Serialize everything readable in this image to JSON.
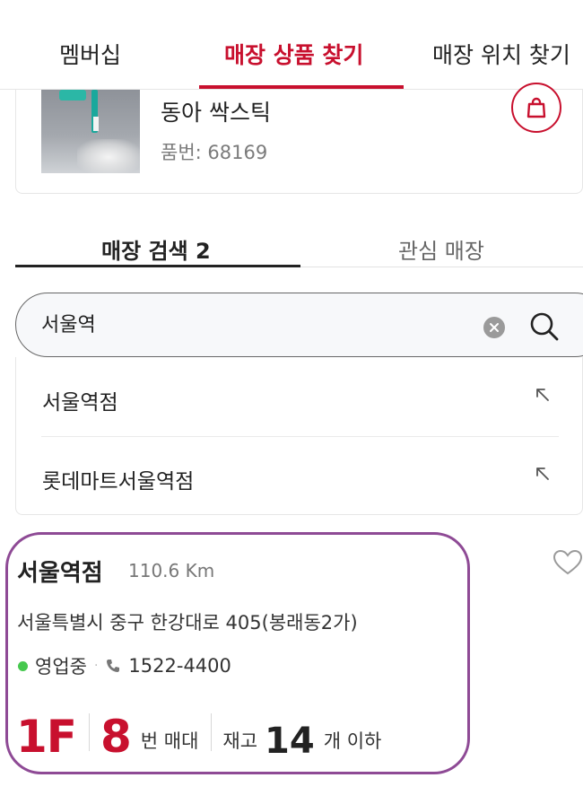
{
  "nav": {
    "tabs": [
      {
        "label": "멤버십"
      },
      {
        "label": "매장 상품 찾기"
      },
      {
        "label": "매장 위치 찾기"
      }
    ],
    "active_index": 1
  },
  "product": {
    "name": "동아 싹스틱",
    "code": "품번: 68169"
  },
  "subtabs": [
    {
      "label": "매장 검색 2"
    },
    {
      "label": "관심 매장"
    }
  ],
  "search": {
    "value": "서울역"
  },
  "suggestions": [
    {
      "label": "서울역점"
    },
    {
      "label": "롯데마트서울역점"
    }
  ],
  "store": {
    "name": "서울역점",
    "distance": "110.6 Km",
    "address": "서울특별시 중구 한강대로 405(봉래동2가)",
    "status": "영업중",
    "separator": "·",
    "phone": "1522-4400",
    "floor": "1F",
    "aisle_number": "8",
    "aisle_label": "번 매대",
    "stock_label": "재고",
    "stock_number": "14",
    "stock_unit": "개 이하"
  },
  "colors": {
    "accent": "#c8102e",
    "status_open": "#46c84e",
    "highlight_border": "#8e4a95"
  },
  "icons": {
    "bag": "shopping-bag-icon",
    "clear": "clear-icon",
    "search": "search-icon",
    "arrow": "arrow-up-left-icon",
    "phone": "phone-icon",
    "heart": "heart-icon"
  }
}
